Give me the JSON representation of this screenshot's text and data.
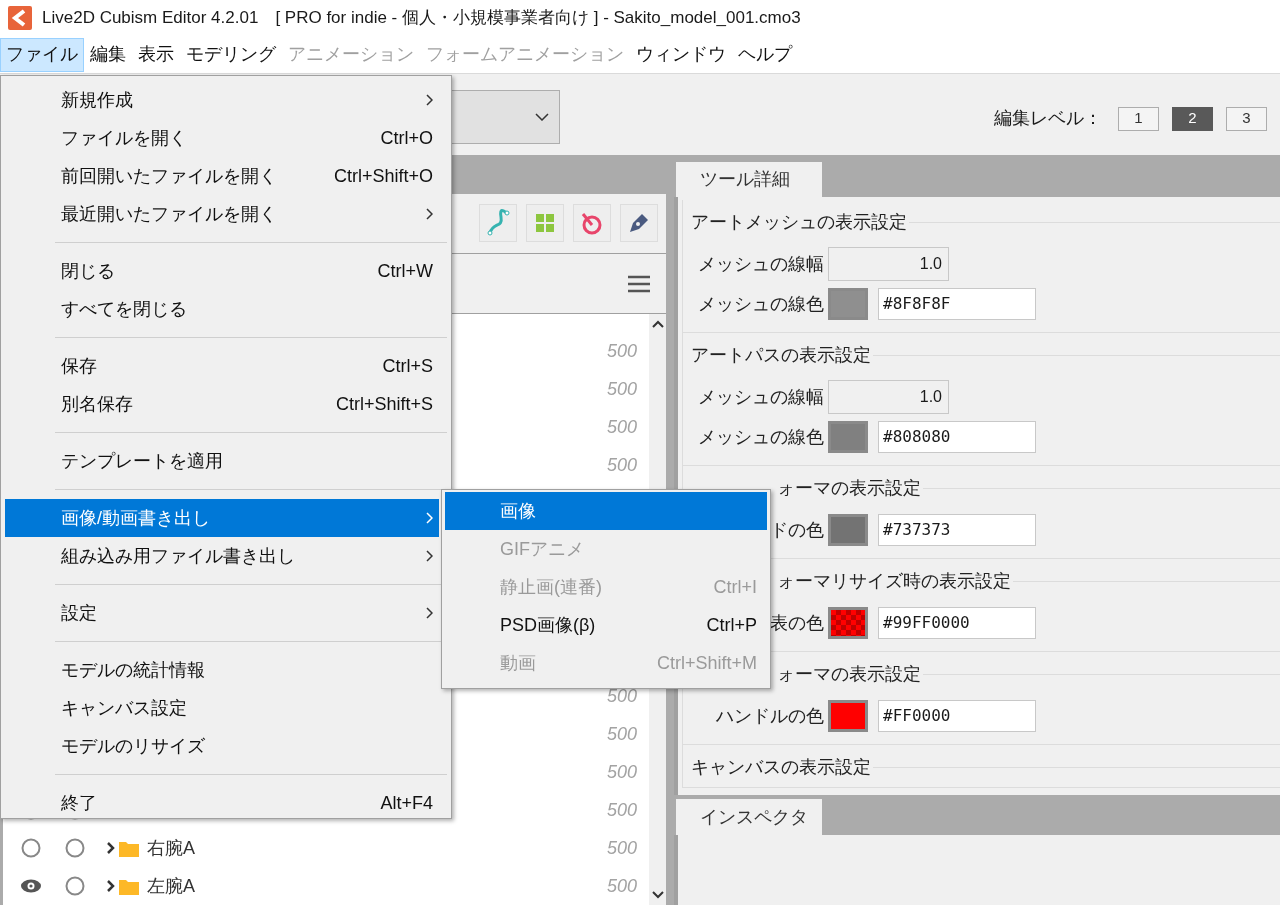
{
  "window": {
    "title": "Live2D Cubism Editor 4.2.01　[ PRO for indie - 個人・小規模事業者向け ] - Sakito_model_001.cmo3"
  },
  "menubar": [
    {
      "label": "ファイル",
      "selected": true,
      "disabled": false
    },
    {
      "label": "編集",
      "selected": false,
      "disabled": false
    },
    {
      "label": "表示",
      "selected": false,
      "disabled": false
    },
    {
      "label": "モデリング",
      "selected": false,
      "disabled": false
    },
    {
      "label": "アニメーション",
      "selected": false,
      "disabled": true
    },
    {
      "label": "フォームアニメーション",
      "selected": false,
      "disabled": true
    },
    {
      "label": "ウィンドウ",
      "selected": false,
      "disabled": false
    },
    {
      "label": "ヘルプ",
      "selected": false,
      "disabled": false
    }
  ],
  "edit_level": {
    "label": "編集レベル：",
    "buttons": [
      {
        "label": "1",
        "selected": false
      },
      {
        "label": "2",
        "selected": true
      },
      {
        "label": "3",
        "selected": false
      }
    ]
  },
  "file_menu": [
    {
      "kind": "item",
      "label": "新規作成",
      "submenu": true,
      "selected": false
    },
    {
      "kind": "item",
      "label": "ファイルを開く",
      "shortcut": "Ctrl+O",
      "selected": false
    },
    {
      "kind": "item",
      "label": "前回開いたファイルを開く",
      "shortcut": "Ctrl+Shift+O",
      "selected": false
    },
    {
      "kind": "item",
      "label": "最近開いたファイルを開く",
      "submenu": true,
      "selected": false
    },
    {
      "kind": "separator"
    },
    {
      "kind": "item",
      "label": "閉じる",
      "shortcut": "Ctrl+W",
      "selected": false
    },
    {
      "kind": "item",
      "label": "すべてを閉じる",
      "selected": false
    },
    {
      "kind": "separator"
    },
    {
      "kind": "item",
      "label": "保存",
      "shortcut": "Ctrl+S",
      "selected": false
    },
    {
      "kind": "item",
      "label": "別名保存",
      "shortcut": "Ctrl+Shift+S",
      "selected": false
    },
    {
      "kind": "separator"
    },
    {
      "kind": "item",
      "label": "テンプレートを適用",
      "selected": false
    },
    {
      "kind": "separator"
    },
    {
      "kind": "item",
      "label": "画像/動画書き出し",
      "submenu": true,
      "selected": true
    },
    {
      "kind": "item",
      "label": "組み込み用ファイル書き出し",
      "submenu": true,
      "selected": false
    },
    {
      "kind": "separator"
    },
    {
      "kind": "item",
      "label": "設定",
      "submenu": true,
      "selected": false
    },
    {
      "kind": "separator"
    },
    {
      "kind": "item",
      "label": "モデルの統計情報",
      "selected": false
    },
    {
      "kind": "item",
      "label": "キャンバス設定",
      "selected": false
    },
    {
      "kind": "item",
      "label": "モデルのリサイズ",
      "selected": false
    },
    {
      "kind": "separator"
    },
    {
      "kind": "item",
      "label": "終了",
      "shortcut": "Alt+F4",
      "selected": false
    }
  ],
  "export_submenu": [
    {
      "label": "画像",
      "selected": true,
      "disabled": false
    },
    {
      "label": "GIFアニメ",
      "selected": false,
      "disabled": true
    },
    {
      "label": "静止画(連番)",
      "shortcut": "Ctrl+I",
      "selected": false,
      "disabled": true
    },
    {
      "label": "PSD画像(β)",
      "shortcut": "Ctrl+P",
      "selected": false,
      "disabled": false
    },
    {
      "label": "動画",
      "shortcut": "Ctrl+Shift+M",
      "selected": false,
      "disabled": true
    }
  ],
  "layer_rows_upper": [
    {
      "value": "500"
    },
    {
      "value": "500"
    },
    {
      "value": "500"
    },
    {
      "value": "500"
    }
  ],
  "layer_rows_lower": [
    {
      "value": "500"
    },
    {
      "value": "500"
    },
    {
      "value": "500"
    },
    {
      "value": "500",
      "visible": false
    },
    {
      "value": "500",
      "visible": false,
      "name": "右腕A"
    },
    {
      "value": "500",
      "visible": true,
      "name": "左腕A"
    }
  ],
  "tool_details": {
    "tab": "ツール詳細",
    "groups": [
      {
        "title": "アートメッシュの表示設定",
        "rows": [
          {
            "kind": "number",
            "label": "メッシュの線幅",
            "value": "1.0"
          },
          {
            "kind": "color",
            "label": "メッシュの線色",
            "value": "#8F8F8F",
            "color": "#8f8f8f",
            "checker": false
          }
        ]
      },
      {
        "title": "アートパスの表示設定",
        "rows": [
          {
            "kind": "number",
            "label": "メッシュの線幅",
            "value": "1.0"
          },
          {
            "kind": "color",
            "label": "メッシュの線色",
            "value": "#808080",
            "color": "#808080",
            "checker": false
          }
        ]
      },
      {
        "title": "ォーマの表示設定",
        "cut_left": true,
        "rows": [
          {
            "kind": "color",
            "label": "ドの色",
            "value": "#737373",
            "color": "#737373",
            "checker": false
          }
        ]
      },
      {
        "title": "ォーマリサイズ時の表示設定",
        "cut_left": true,
        "rows": [
          {
            "kind": "color",
            "label": "表の色",
            "value": "#99FF0000",
            "color": "#ff0000",
            "checker": true
          }
        ]
      },
      {
        "title": "ォーマの表示設定",
        "cut_left": true,
        "rows": [
          {
            "kind": "color",
            "label": "ハンドルの色",
            "value": "#FF0000",
            "color": "#ff0000",
            "checker": false
          }
        ]
      },
      {
        "title": "キャンバスの表示設定"
      }
    ]
  },
  "inspector": {
    "tab": "インスペクタ"
  }
}
